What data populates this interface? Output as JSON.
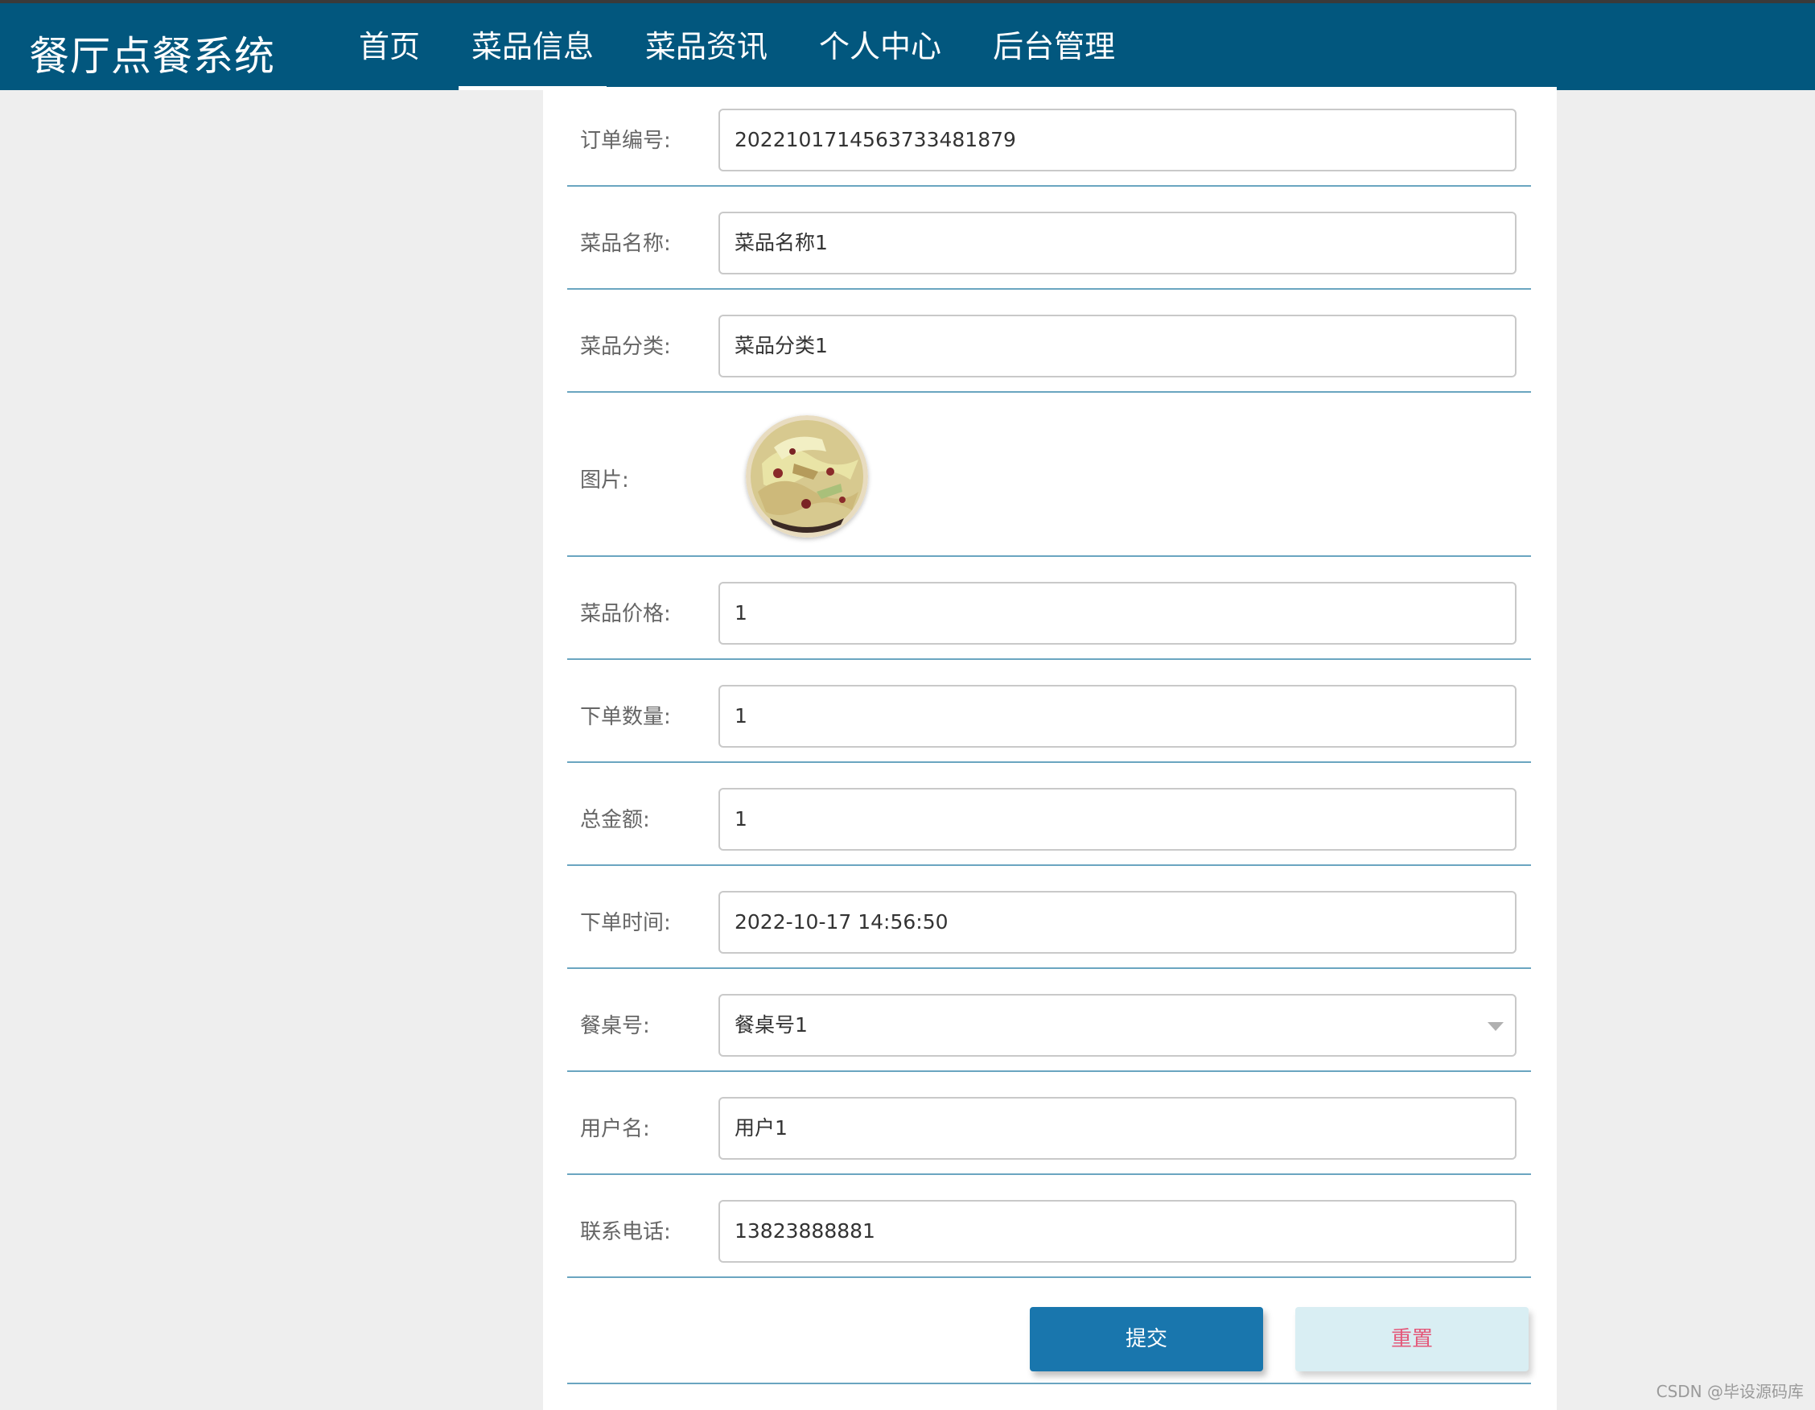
{
  "header": {
    "brand": "餐厅点餐系统",
    "nav": [
      {
        "label": "首页"
      },
      {
        "label": "菜品信息",
        "active": true
      },
      {
        "label": "菜品资讯"
      },
      {
        "label": "个人中心"
      },
      {
        "label": "后台管理"
      }
    ]
  },
  "form": {
    "order_no": {
      "label": "订单编号:",
      "value": "20221017145637334818​79"
    },
    "dish_name": {
      "label": "菜品名称:",
      "value": "菜品名称1"
    },
    "dish_category": {
      "label": "菜品分类:",
      "value": "菜品分类1"
    },
    "image": {
      "label": "图片:"
    },
    "price": {
      "label": "菜品价格:",
      "value": "1"
    },
    "quantity": {
      "label": "下单数量:",
      "value": "1"
    },
    "total": {
      "label": "总金额:",
      "value": "1"
    },
    "order_time": {
      "label": "下单时间:",
      "value": "2022-10-17 14:56:50"
    },
    "table_no": {
      "label": "餐桌号:",
      "value": "餐桌号1"
    },
    "username": {
      "label": "用户名:",
      "value": "用户1"
    },
    "phone": {
      "label": "联系电话:",
      "value": "13823888881"
    }
  },
  "buttons": {
    "submit": "提交",
    "reset": "重置"
  },
  "watermark": "CSDN @毕设源码库",
  "colors": {
    "header_bg": "#02577e",
    "submit_bg": "#1976ad",
    "reset_bg": "#d9eef3",
    "reset_text": "#e4587a",
    "divider": "#6aa5c0"
  }
}
